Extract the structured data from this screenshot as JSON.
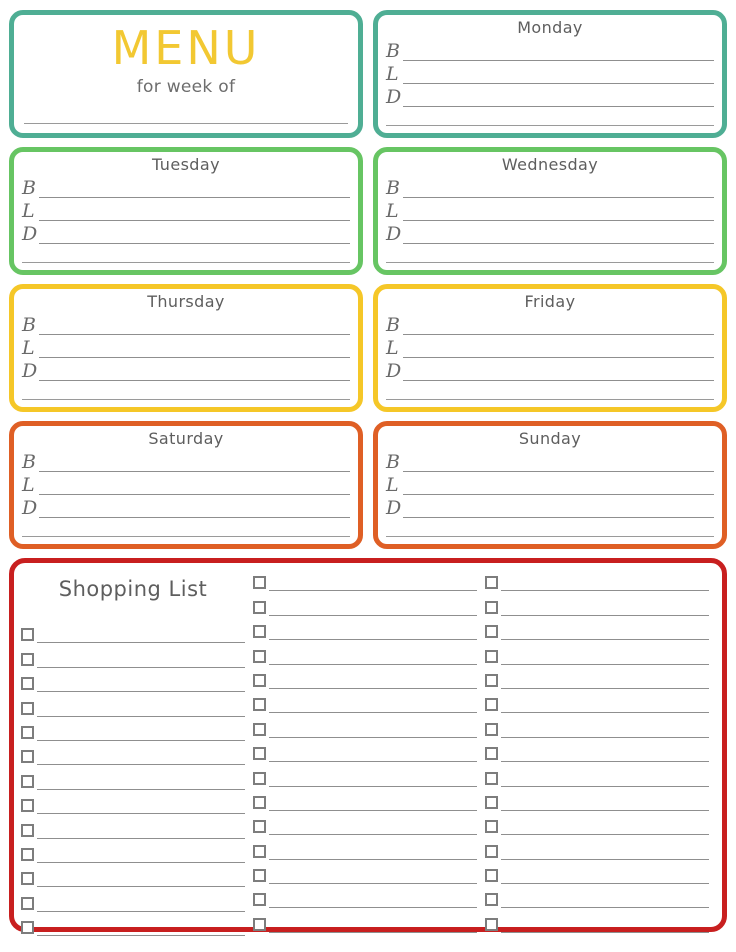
{
  "header": {
    "title": "MENU",
    "subtitle": "for week of",
    "title_color": "#f2c832",
    "border_color": "#4fae94"
  },
  "meal_labels": [
    "B",
    "L",
    "D"
  ],
  "days": [
    {
      "name": "Monday",
      "color_class": "teal",
      "border_color": "#4fae94"
    },
    {
      "name": "Tuesday",
      "color_class": "green",
      "border_color": "#67c563"
    },
    {
      "name": "Wednesday",
      "color_class": "green",
      "border_color": "#67c563"
    },
    {
      "name": "Thursday",
      "color_class": "yellow",
      "border_color": "#f5c728"
    },
    {
      "name": "Friday",
      "color_class": "yellow",
      "border_color": "#f5c728"
    },
    {
      "name": "Saturday",
      "color_class": "red",
      "border_color": "#df5f25"
    },
    {
      "name": "Sunday",
      "color_class": "red",
      "border_color": "#df5f25"
    }
  ],
  "shopping_list": {
    "title": "Shopping List",
    "border_color": "#c81f1f",
    "columns": [
      {
        "has_title": true,
        "rows": 13
      },
      {
        "has_title": false,
        "rows": 15
      },
      {
        "has_title": false,
        "rows": 15
      }
    ]
  }
}
